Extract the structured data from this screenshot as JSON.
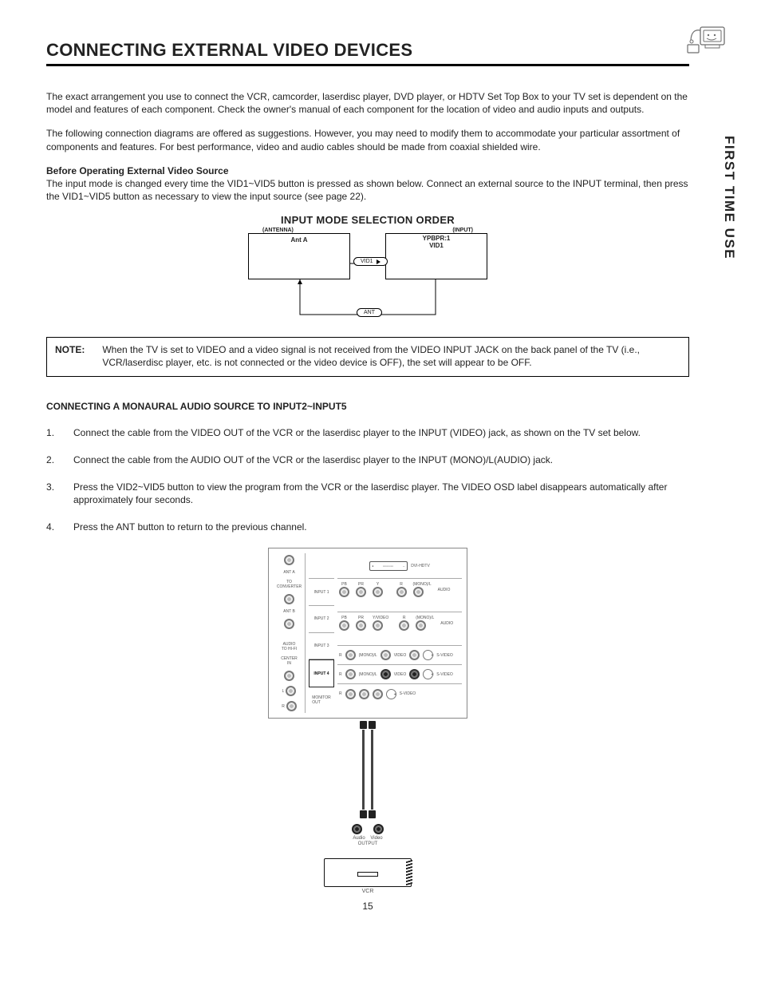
{
  "sideTab": "FIRST TIME USE",
  "title": "CONNECTING EXTERNAL VIDEO DEVICES",
  "intro1": "The exact arrangement you use to connect the VCR, camcorder, laserdisc player, DVD player, or HDTV Set Top Box to your TV set is dependent on the model and features of each component.  Check the owner's manual of each component for the location of video and audio inputs and outputs.",
  "intro2": "The following connection diagrams are offered as suggestions.  However, you may need to modify them to accommodate your particular assortment of components and features.  For best performance, video and audio cables should be made from coaxial shielded wire.",
  "beforeHeading": "Before Operating External Video Source",
  "beforeText": "The input mode is changed every time the VID1~VID5 button is pressed as shown below.  Connect an external source to the INPUT terminal, then press the VID1~VID5 button as necessary to view the input source (see page 22).",
  "diagram": {
    "title": "INPUT MODE SELECTION ORDER",
    "leftLabel": "(ANTENNA)",
    "rightLabel": "(INPUT)",
    "leftBox": "Ant A",
    "rightBoxLine1": "YPBPR:1",
    "rightBoxLine2": "VID1",
    "pillTop": "VID1",
    "pillBottom": "ANT"
  },
  "note": {
    "label": "NOTE:",
    "text": "When the TV is set to VIDEO and a video signal is not received from the VIDEO INPUT JACK on the back panel of the TV (i.e., VCR/laserdisc player, etc. is not connected or the video device is OFF), the set will appear to be OFF."
  },
  "subheading": "CONNECTING A MONAURAL AUDIO SOURCE TO INPUT2~INPUT5",
  "steps": [
    "Connect the cable from the VIDEO OUT of the VCR or the laserdisc player to the INPUT (VIDEO) jack, as shown on the TV set below.",
    "Connect the cable from the AUDIO OUT of the VCR or the laserdisc player to the INPUT (MONO)/L(AUDIO) jack.",
    "Press the VID2~VID5 button to view the program from the VCR or the laserdisc player.  The VIDEO OSD label disappears automatically after approximately four seconds.",
    "Press the ANT button to return to the previous channel."
  ],
  "panel": {
    "antA": "ANT A",
    "toConv": "TO\nCONVERTER",
    "antB": "ANT B",
    "audioHiFi": "AUDIO\nTO HI-FI",
    "centerIn": "CENTER\nIN",
    "l": "L",
    "r": "R",
    "input1": "INPUT 1",
    "input2": "INPUT 2",
    "input3": "INPUT 3",
    "input4": "INPUT 4",
    "monitorOut": "MONITOR\nOUT",
    "dvi": "DVI-HDTV",
    "pb": "PB",
    "pr": "PR",
    "y": "Y",
    "yvideo": "Y/VIDEO",
    "rlbl": "R",
    "monoL": "(MONO)/L",
    "audio": "AUDIO",
    "video": "VIDEO",
    "svideo": "S-VIDEO",
    "outLabel1": "Audio",
    "outLabel2": "Video",
    "outLabel3": "OUTPUT",
    "vcr": "VCR"
  },
  "pageNumber": "15"
}
